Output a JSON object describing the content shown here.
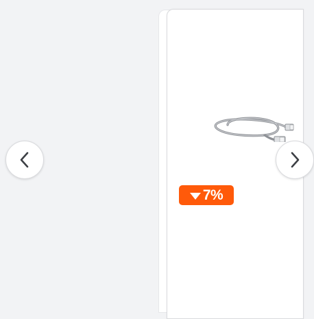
{
  "carousel": {
    "prev_icon": "chevron-left-icon",
    "next_icon": "chevron-right-icon"
  },
  "product": {
    "image_icon": "ethernet-cable-image",
    "discount_text": "7%",
    "discount_icon": "triangle-down-icon",
    "badge_color": "#ff5a0a"
  }
}
